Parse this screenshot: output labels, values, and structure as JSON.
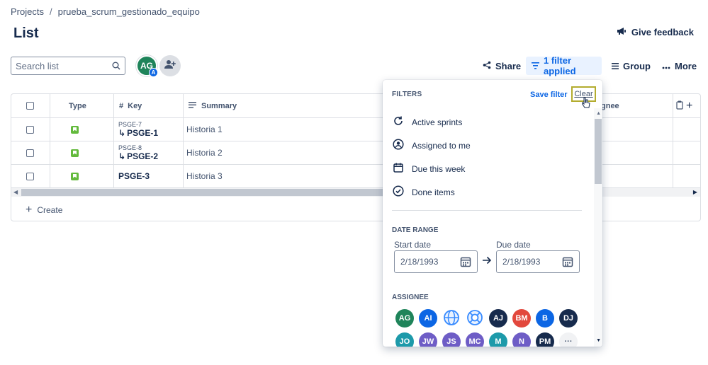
{
  "breadcrumb": {
    "root": "Projects",
    "separator": "/",
    "project": "prueba_scrum_gestionado_equipo"
  },
  "page": {
    "title": "List",
    "feedback": "Give feedback"
  },
  "search": {
    "placeholder": "Search list",
    "value": ""
  },
  "people": {
    "avatar": "AG",
    "avatar_badge": "A"
  },
  "toolbar": {
    "share": "Share",
    "filter": "1 filter applied",
    "group": "Group",
    "more": "More"
  },
  "table": {
    "headers": {
      "type": "Type",
      "key": "Key",
      "summary": "Summary",
      "assignee_partial": "gnee"
    },
    "rows": [
      {
        "key_parent": "PSGE-7",
        "key": "PSGE-1",
        "summary": "Historia 1"
      },
      {
        "key_parent": "PSGE-8",
        "key": "PSGE-2",
        "summary": "Historia 2"
      },
      {
        "key_parent": "",
        "key": "PSGE-3",
        "summary": "Historia 3"
      }
    ],
    "create": "Create"
  },
  "filters": {
    "title": "FILTERS",
    "save": "Save filter",
    "clear": "Clear",
    "options": [
      {
        "label": "Active sprints",
        "icon": "sprint-icon"
      },
      {
        "label": "Assigned to me",
        "icon": "user-circle-icon"
      },
      {
        "label": "Due this week",
        "icon": "calendar-icon"
      },
      {
        "label": "Done items",
        "icon": "check-circle-icon"
      }
    ],
    "date_range": {
      "label": "DATE RANGE",
      "start_label": "Start date",
      "start_value": "2/18/1993",
      "due_label": "Due date",
      "due_value": "2/18/1993"
    },
    "assignee": {
      "label": "ASSIGNEE",
      "row1": [
        {
          "text": "AG",
          "color": "#1f845a"
        },
        {
          "text": "AI",
          "color": "#0c66e4"
        },
        {
          "text": "",
          "color": "#ffffff",
          "icon": "globe-icon"
        },
        {
          "text": "",
          "color": "#ffffff",
          "icon": "lifebuoy-icon"
        },
        {
          "text": "AJ",
          "color": "#172b4d"
        },
        {
          "text": "BM",
          "color": "#e2483d"
        },
        {
          "text": "B",
          "color": "#0c66e4"
        },
        {
          "text": "DJ",
          "color": "#172b4d"
        }
      ],
      "row2": [
        {
          "text": "JO",
          "color": "#1d9aaa"
        },
        {
          "text": "JW",
          "color": "#6e5dc6"
        },
        {
          "text": "JS",
          "color": "#6e5dc6"
        },
        {
          "text": "MC",
          "color": "#6e5dc6"
        },
        {
          "text": "M",
          "color": "#1d9aaa"
        },
        {
          "text": "N",
          "color": "#6e5dc6"
        },
        {
          "text": "PM",
          "color": "#172b4d"
        },
        {
          "text": "···",
          "color": "#f1f2f4"
        }
      ]
    }
  }
}
